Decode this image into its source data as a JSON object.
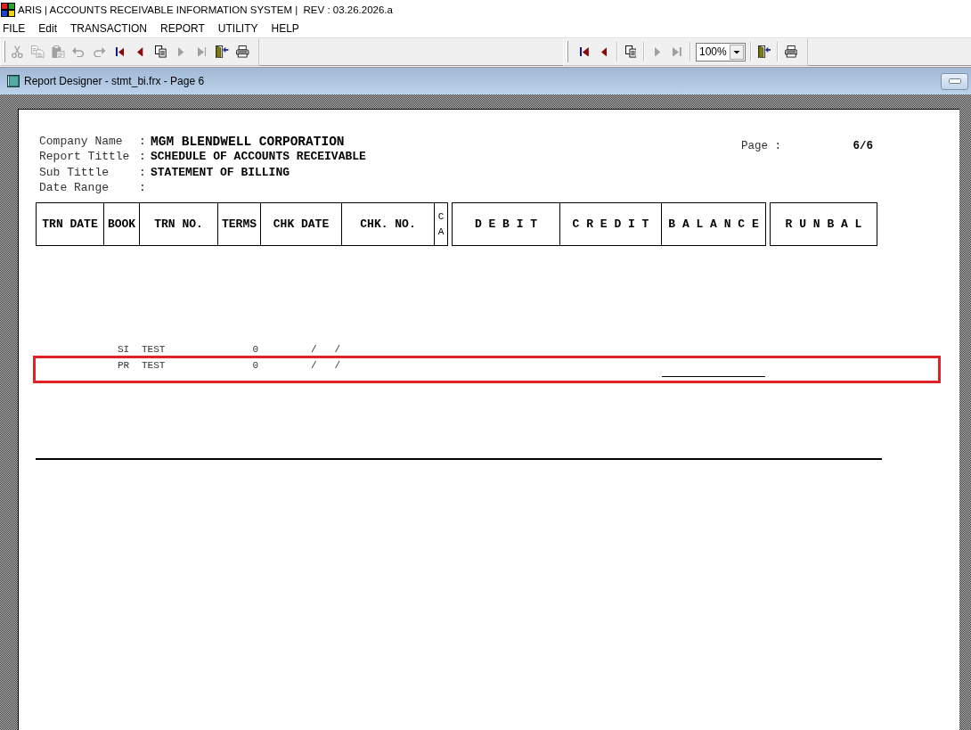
{
  "window": {
    "title": "ARIS | ACCOUNTS RECEIVABLE INFORMATION SYSTEM |  REV : 03.26.2026.a"
  },
  "menu": [
    {
      "label": "FILE"
    },
    {
      "label": "Edit"
    },
    {
      "label": "TRANSACTION"
    },
    {
      "label": "REPORT"
    },
    {
      "label": "UTILITY"
    },
    {
      "label": "HELP"
    }
  ],
  "toolbars": [
    {
      "items": [
        {
          "kind": "cut",
          "disabled": true
        },
        {
          "kind": "copy",
          "disabled": true
        },
        {
          "kind": "paste",
          "disabled": true
        },
        {
          "kind": "undo",
          "disabled": true
        },
        {
          "kind": "redo",
          "disabled": true
        },
        {
          "kind": "first",
          "disabled": false
        },
        {
          "kind": "previous",
          "disabled": false
        },
        {
          "kind": "pages",
          "disabled": false
        },
        {
          "kind": "next",
          "disabled": true
        },
        {
          "kind": "last",
          "disabled": true
        },
        {
          "kind": "exit",
          "disabled": false
        },
        {
          "kind": "print",
          "disabled": false
        }
      ]
    },
    {
      "items": [
        {
          "kind": "first",
          "disabled": false
        },
        {
          "kind": "previous",
          "disabled": false
        },
        {
          "kind": "separator"
        },
        {
          "kind": "pages",
          "disabled": false
        },
        {
          "kind": "separator"
        },
        {
          "kind": "next",
          "disabled": true
        },
        {
          "kind": "last",
          "disabled": true
        },
        {
          "kind": "separator"
        },
        {
          "kind": "zoom",
          "value": "100%"
        },
        {
          "kind": "separator"
        },
        {
          "kind": "exit",
          "disabled": false
        },
        {
          "kind": "separator"
        },
        {
          "kind": "print",
          "disabled": false
        }
      ]
    }
  ],
  "document_window": {
    "title": "Report Designer - stmt_bi.frx - Page 6"
  },
  "report": {
    "header_fields": [
      {
        "label": "Company Name",
        "colon": ":",
        "value": "MGM BLENDWELL CORPORATION"
      },
      {
        "label": "Report Tittle",
        "colon": ":",
        "value": "SCHEDULE OF ACCOUNTS RECEIVABLE"
      },
      {
        "label": "Sub Tittle",
        "colon": ":",
        "value": "STATEMENT OF BILLING"
      },
      {
        "label": "Date Range",
        "colon": ":"
      }
    ],
    "page_label": "Page :",
    "page_number": "6/6",
    "column_groups": [
      {
        "columns": [
          {
            "label": "TRN DATE"
          },
          {
            "label": "BOOK"
          },
          {
            "label": "TRN NO."
          },
          {
            "label": "TERMS"
          },
          {
            "label": "CHK DATE"
          },
          {
            "label": "CHK. NO."
          },
          {
            "label": "CA"
          }
        ]
      },
      {
        "columns": [
          {
            "label": "D E B I T"
          },
          {
            "label": "C R E D I T"
          },
          {
            "label": "B A L A N C E"
          }
        ]
      },
      {
        "columns": [
          {
            "label": "R U N B A L"
          }
        ]
      }
    ],
    "rows": [
      {
        "book": "SI",
        "trn_no": "TEST",
        "terms": "0",
        "chk_date": "/   /",
        "balance_underlined": false,
        "highlighted": false
      },
      {
        "book": "PR",
        "trn_no": "TEST",
        "terms": "0",
        "chk_date": "/   /",
        "balance_underlined": true,
        "highlighted": true
      }
    ]
  }
}
